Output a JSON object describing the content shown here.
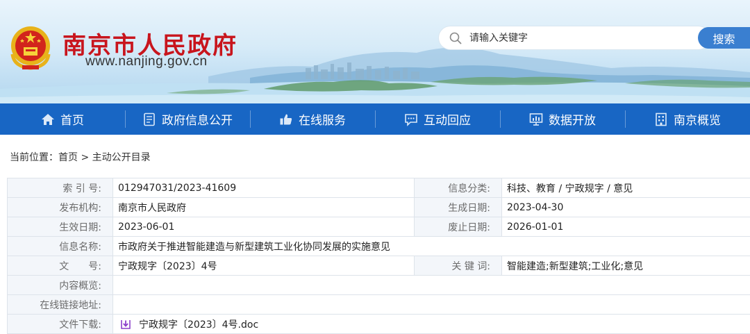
{
  "header": {
    "site_title": "南京市人民政府",
    "site_url": "www.nanjing.gov.cn",
    "search_placeholder": "请输入关键字",
    "search_button": "搜索"
  },
  "nav": [
    {
      "label": "首页",
      "icon": "home-icon"
    },
    {
      "label": "政府信息公开",
      "icon": "document-icon"
    },
    {
      "label": "在线服务",
      "icon": "thumbs-up-icon"
    },
    {
      "label": "互动回应",
      "icon": "chat-icon"
    },
    {
      "label": "数据开放",
      "icon": "chart-icon"
    },
    {
      "label": "南京概览",
      "icon": "building-icon"
    }
  ],
  "breadcrumb": {
    "prefix": "当前位置：",
    "home": "首页",
    "separator": " > ",
    "current": "主动公开目录"
  },
  "info": {
    "index_no_label": "索 引 号:",
    "index_no": "012947031/2023-41609",
    "category_label": "信息分类:",
    "category": "科技、教育 / 宁政规字 / 意见",
    "publisher_label": "发布机构:",
    "publisher": "南京市人民政府",
    "created_label": "生成日期:",
    "created": "2023-04-30",
    "effective_label": "生效日期:",
    "effective": "2023-06-01",
    "expire_label": "废止日期:",
    "expire": "2026-01-01",
    "name_label": "信息名称:",
    "name": "市政府关于推进智能建造与新型建筑工业化协同发展的实施意见",
    "doc_no_label": "文　　号:",
    "doc_no": "宁政规字〔2023〕4号",
    "keywords_label": "关 键 词:",
    "keywords": "智能建造;新型建筑;工业化;意见",
    "summary_label": "内容概览:",
    "summary": "",
    "link_label": "在线链接地址:",
    "link": "",
    "download_label": "文件下载:",
    "download_file": "宁政规字〔2023〕4号.doc"
  },
  "colors": {
    "title_red": "#c8151d",
    "nav_blue": "#1866c4",
    "search_blue": "#3a7fd0"
  }
}
